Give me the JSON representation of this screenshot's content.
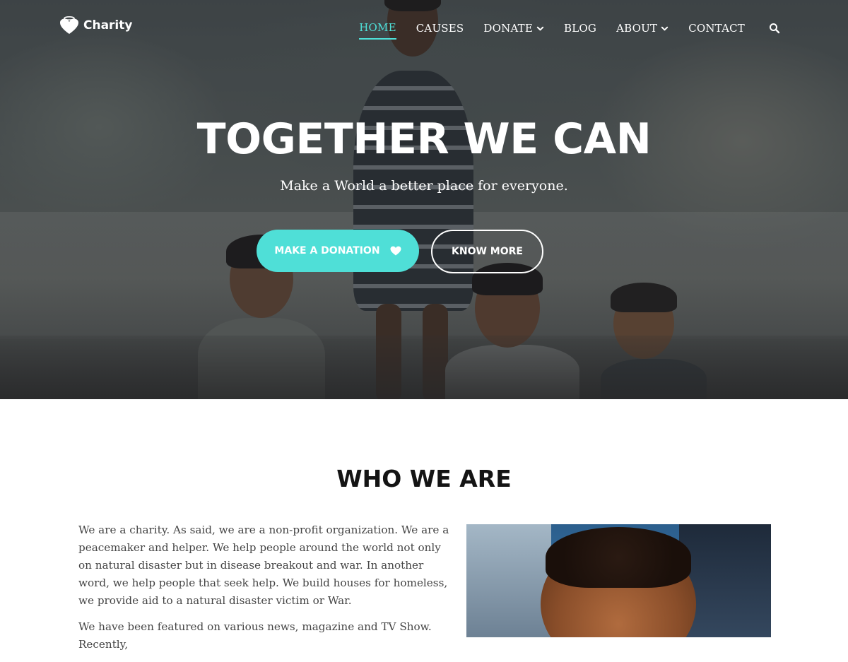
{
  "brand": {
    "name": "Charity",
    "logo_icon": "heart-halo-icon"
  },
  "nav": {
    "items": [
      {
        "label": "HOME",
        "active": true,
        "dropdown": false
      },
      {
        "label": "CAUSES",
        "active": false,
        "dropdown": false
      },
      {
        "label": "DONATE",
        "active": false,
        "dropdown": true
      },
      {
        "label": "BLOG",
        "active": false,
        "dropdown": false
      },
      {
        "label": "ABOUT",
        "active": false,
        "dropdown": true
      },
      {
        "label": "CONTACT",
        "active": false,
        "dropdown": false
      }
    ],
    "search_icon": "search-icon"
  },
  "hero": {
    "title": "TOGETHER WE CAN",
    "subtitle": "Make a World a better place for everyone.",
    "primary_button": "MAKE A DONATION",
    "primary_button_icon": "heart-icon",
    "secondary_button": "KNOW MORE"
  },
  "about": {
    "title": "WHO WE ARE",
    "paragraphs": [
      "We are a charity. As said, we are a non-profit organization. We are a peacemaker and helper. We help people around the world not only on natural disaster but in disease breakout and war.  In another word, we help people that seek help. We build houses for homeless, we provide aid to a natural disaster victim or War.",
      "We have been featured on various news, magazine and TV Show. Recently,"
    ]
  },
  "colors": {
    "accent": "#4fdfd7",
    "heading": "#141414",
    "body_text": "#444444"
  }
}
